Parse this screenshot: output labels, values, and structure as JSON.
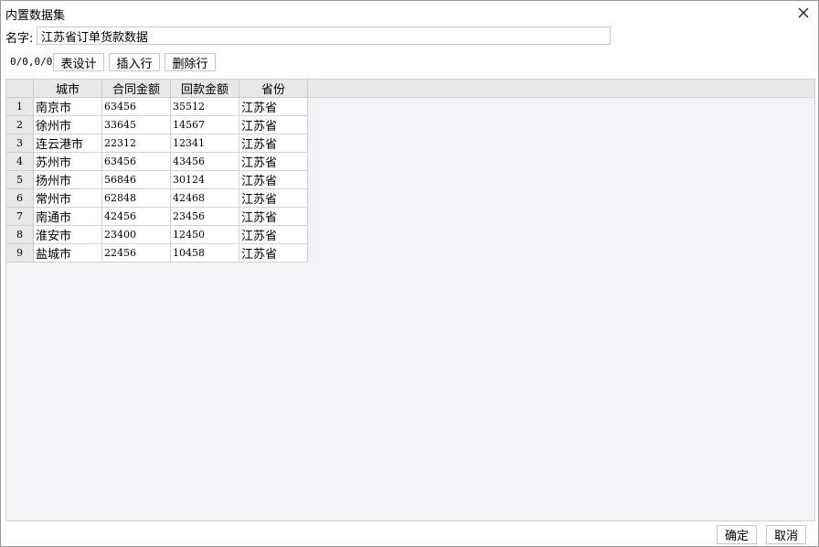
{
  "window": {
    "title": "内置数据集",
    "close_icon": "close-icon"
  },
  "name_field": {
    "label": "名字:",
    "value": "江苏省订单货款数据"
  },
  "toolbar": {
    "counter": "0/0,0/0",
    "table_design_label": "表设计",
    "insert_row_label": "插入行",
    "delete_row_label": "删除行"
  },
  "table": {
    "columns": [
      "城市",
      "合同金额",
      "回款金额",
      "省份"
    ],
    "rows": [
      {
        "index": "1",
        "cells": [
          "南京市",
          "63456",
          "35512",
          "江苏省"
        ]
      },
      {
        "index": "2",
        "cells": [
          "徐州市",
          "33645",
          "14567",
          "江苏省"
        ]
      },
      {
        "index": "3",
        "cells": [
          "连云港市",
          "22312",
          "12341",
          "江苏省"
        ]
      },
      {
        "index": "4",
        "cells": [
          "苏州市",
          "63456",
          "43456",
          "江苏省"
        ]
      },
      {
        "index": "5",
        "cells": [
          "扬州市",
          "56846",
          "30124",
          "江苏省"
        ]
      },
      {
        "index": "6",
        "cells": [
          "常州市",
          "62848",
          "42468",
          "江苏省"
        ]
      },
      {
        "index": "7",
        "cells": [
          "南通市",
          "42456",
          "23456",
          "江苏省"
        ]
      },
      {
        "index": "8",
        "cells": [
          "淮安市",
          "23400",
          "12450",
          "江苏省"
        ]
      },
      {
        "index": "9",
        "cells": [
          "盐城市",
          "22456",
          "10458",
          "江苏省"
        ]
      }
    ]
  },
  "footer": {
    "ok_label": "确定",
    "cancel_label": "取消"
  }
}
